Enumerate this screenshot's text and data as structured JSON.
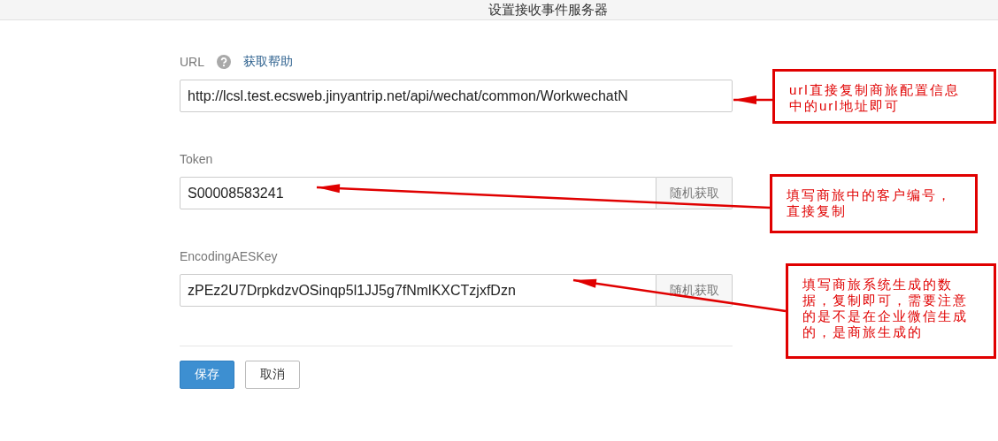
{
  "header": {
    "title": "设置接收事件服务器"
  },
  "fields": [
    {
      "label": "URL",
      "help_link": "获取帮助",
      "value": "http://lcsl.test.ecsweb.jinyantrip.net/api/wechat/common/WorkwechatN"
    },
    {
      "label": "Token",
      "value": "S00008583241",
      "action": "随机获取"
    },
    {
      "label": "EncodingAESKey",
      "value": "zPEz2U7DrpkdzvOSinqp5l1JJ5g7fNmlKXCTzjxfDzn",
      "action": "随机获取"
    }
  ],
  "buttons": [
    {
      "label": "保存",
      "kind": "primary"
    },
    {
      "label": "取消",
      "kind": "default"
    }
  ],
  "annotations": [
    {
      "lines": [
        "url直接复制商旅配置信息",
        "中的url地址即可"
      ]
    },
    {
      "lines": [
        "填写商旅中的客户编号，",
        "直接复制"
      ]
    },
    {
      "lines": [
        "填写商旅系统生成的数",
        "据，复制即可，需要注意",
        "的是不是在企业微信生成",
        "的，是商旅生成的"
      ]
    }
  ]
}
